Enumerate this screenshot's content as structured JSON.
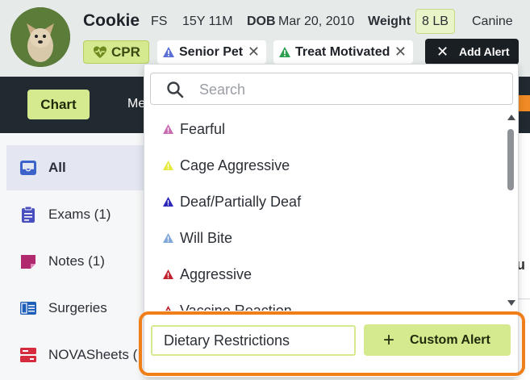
{
  "patient": {
    "name": "Cookie",
    "sex": "FS",
    "age": "15Y 11M",
    "dob_label": "DOB",
    "dob": "Mar 20, 2010",
    "weight_label": "Weight",
    "weight": "8 LB",
    "species": "Canine"
  },
  "badges": {
    "cpr": "CPR"
  },
  "alerts": [
    {
      "label": "Senior Pet",
      "color": "#5b6fd6"
    },
    {
      "label": "Treat Motivated",
      "color": "#2e9e4f"
    }
  ],
  "add_alert_label": "Add Alert",
  "nav": {
    "chart_tab": "Chart",
    "next_tab_partial": "Me"
  },
  "sidebar": {
    "items": [
      {
        "label": "All",
        "icon": "inbox-icon"
      },
      {
        "label": "Exams (1)",
        "icon": "clipboard-icon"
      },
      {
        "label": "Notes (1)",
        "icon": "note-icon"
      },
      {
        "label": "Surgeries",
        "icon": "book-icon"
      },
      {
        "label": "NOVASheets (",
        "icon": "sheets-icon"
      }
    ]
  },
  "dropdown": {
    "search_placeholder": "Search",
    "options": [
      {
        "label": "Fearful",
        "color": "#c86bb0"
      },
      {
        "label": "Cage Aggressive",
        "color": "#e6ea3a"
      },
      {
        "label": "Deaf/Partially Deaf",
        "color": "#2a27b8"
      },
      {
        "label": "Will Bite",
        "color": "#7fa7dc"
      },
      {
        "label": "Aggressive",
        "color": "#c0232e"
      },
      {
        "label": "Vaccine Reaction",
        "color": "#c0232e"
      }
    ],
    "custom_input_value": "Dietary Restrictions",
    "custom_button_label": "Custom Alert"
  },
  "content_peek_text": "u",
  "colors": {
    "accent_green": "#d5e98f",
    "highlight_orange": "#f07f1a",
    "nav_dark": "#222a31"
  }
}
